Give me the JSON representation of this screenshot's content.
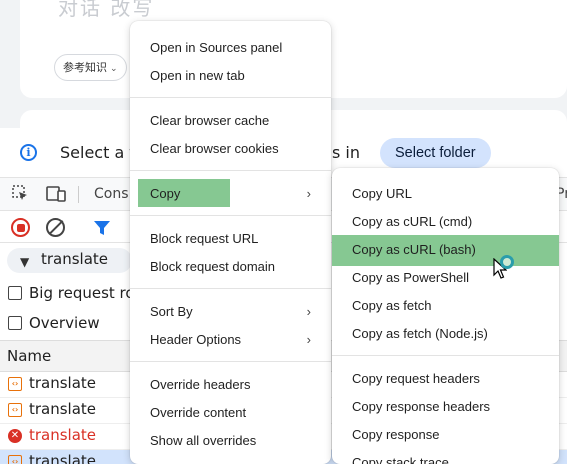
{
  "chat": {
    "ghost_text": "对话 改写",
    "chip_label": "参考知识",
    "chip_chevron": "⌄"
  },
  "infobar": {
    "text_before": "Select a f",
    "text_after": "s in",
    "button_label": "Select folder"
  },
  "tabs": {
    "console_partial": "Cons",
    "right_partial": "Pr"
  },
  "filter": {
    "value": "translate"
  },
  "options": {
    "big_request_rows": "Big request ro",
    "overview": "Overview"
  },
  "table": {
    "name_header": "Name",
    "rows": [
      {
        "name": "translate",
        "status": "ok"
      },
      {
        "name": "translate",
        "status": "ok"
      },
      {
        "name": "translate",
        "status": "error"
      },
      {
        "name": "translate",
        "status": "selected"
      }
    ]
  },
  "menu_main": {
    "items": [
      {
        "label": "Open in Sources panel"
      },
      {
        "label": "Open in new tab"
      },
      {
        "label": "Clear browser cache"
      },
      {
        "label": "Clear browser cookies"
      },
      {
        "label": "Copy",
        "submenu": true
      },
      {
        "label": "Block request URL"
      },
      {
        "label": "Block request domain"
      },
      {
        "label": "Sort By",
        "submenu": true
      },
      {
        "label": "Header Options",
        "submenu": true
      },
      {
        "label": "Override headers"
      },
      {
        "label": "Override content"
      },
      {
        "label": "Show all overrides"
      }
    ],
    "submenu_arrow": "›"
  },
  "menu_copy": {
    "items": [
      {
        "label": "Copy URL"
      },
      {
        "label": "Copy as cURL (cmd)"
      },
      {
        "label": "Copy as cURL (bash)"
      },
      {
        "label": "Copy as PowerShell"
      },
      {
        "label": "Copy as fetch"
      },
      {
        "label": "Copy as fetch (Node.js)"
      },
      {
        "label": "Copy request headers"
      },
      {
        "label": "Copy response headers"
      },
      {
        "label": "Copy response"
      },
      {
        "label": "Copy stack trace"
      }
    ]
  },
  "colors": {
    "highlight": "#86c892",
    "accent_blue": "#1a73e8",
    "error_red": "#d93025",
    "button_bg": "#d3e3fd"
  }
}
